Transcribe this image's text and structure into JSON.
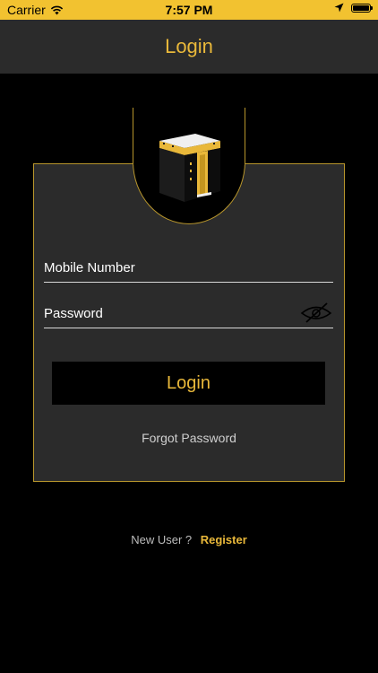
{
  "status_bar": {
    "carrier": "Carrier",
    "time": "7:57 PM",
    "icons": [
      "wifi-icon",
      "location-arrow-icon",
      "battery-icon"
    ]
  },
  "nav": {
    "title": "Login"
  },
  "form": {
    "mobile_placeholder": "Mobile Number",
    "password_placeholder": "Password",
    "password_toggle_icon": "eye-slash-icon",
    "login_label": "Login",
    "forgot_label": "Forgot Password"
  },
  "footer": {
    "new_user_label": "New User ?",
    "register_label": "Register"
  },
  "colors": {
    "accent": "#e9b83a",
    "status_bar": "#f2c230",
    "surface": "#2b2b2b",
    "background": "#000000",
    "card_border": "#b8962c"
  },
  "logo_icon": "kaaba-icon"
}
